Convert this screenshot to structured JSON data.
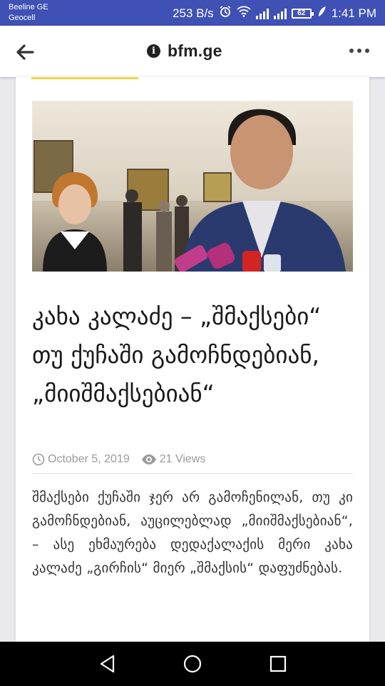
{
  "status_bar": {
    "carrier_line1": "Beeline GE",
    "carrier_line2": "Geocell",
    "net_speed": "253 B/s",
    "battery": "62",
    "time": "1:41 PM"
  },
  "browser": {
    "url": "bfm.ge"
  },
  "article": {
    "title": "კახა კალაძე – „შმაქსები“ თუ ქუჩაში გამოჩნდებიან, „მიიშმაქსებიან“",
    "date": "October 5, 2019",
    "views": "21 Views",
    "body": "შმაქსები ქუჩაში ჯერ არ გამოჩენილან, თუ კი გამოჩნდებიან, აუცილებლად „მიიშმაქსებიან“, – ასე ეხმაურება დედაქალაქის მერი კახა კალაძე „გირჩის“ მიერ „შმაქსის“ დაფუძნებას."
  },
  "colors": {
    "status_bar": "#3f51b5",
    "meta_text": "#9a9a9a",
    "accent_strip": "#e8d84a"
  }
}
